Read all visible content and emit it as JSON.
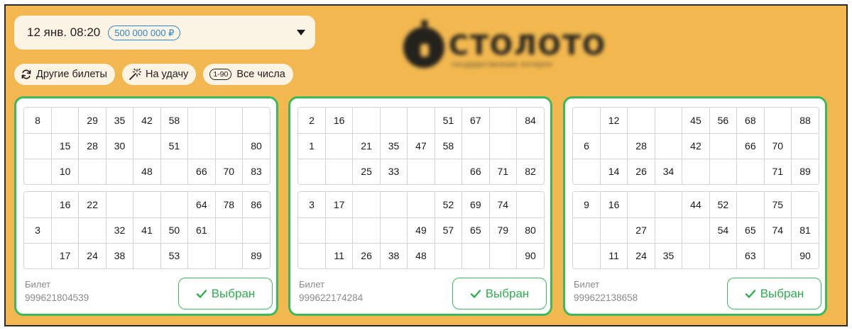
{
  "draw": {
    "date": "12 янв. 08:20",
    "jackpot": "500 000 000 ₽",
    "dropdown_icon": "caret-down-icon"
  },
  "logo": {
    "word": "СТОЛОТО",
    "subtitle": "государственная лотерея"
  },
  "actions": {
    "other_tickets": "Другие билеты",
    "other_tickets_icon": "refresh-icon",
    "random": "На удачу",
    "random_icon": "magic-wand-icon",
    "range_badge": "1-90",
    "all_numbers": "Все числа"
  },
  "colors": {
    "background": "#f2b84f",
    "accent_green": "#3cb95a",
    "jackpot_blue": "#2f86c7"
  },
  "tickets": [
    {
      "label": "Билет",
      "number": "999621804539",
      "button": "Выбран",
      "fields": [
        [
          [
            "8",
            "",
            "29",
            "35",
            "42",
            "58",
            "",
            "",
            ""
          ],
          [
            "",
            "15",
            "28",
            "30",
            "",
            "51",
            "",
            "",
            "80"
          ],
          [
            "",
            "10",
            "",
            "",
            "48",
            "",
            "66",
            "70",
            "83"
          ]
        ],
        [
          [
            "",
            "16",
            "22",
            "",
            "",
            "",
            "64",
            "78",
            "86"
          ],
          [
            "3",
            "",
            "",
            "32",
            "41",
            "50",
            "61",
            "",
            ""
          ],
          [
            "",
            "17",
            "24",
            "38",
            "",
            "53",
            "",
            "",
            "89"
          ]
        ]
      ]
    },
    {
      "label": "Билет",
      "number": "999622174284",
      "button": "Выбран",
      "fields": [
        [
          [
            "2",
            "16",
            "",
            "",
            "",
            "51",
            "67",
            "",
            "84"
          ],
          [
            "1",
            "",
            "21",
            "35",
            "47",
            "58",
            "",
            "",
            ""
          ],
          [
            "",
            "",
            "25",
            "33",
            "",
            "",
            "66",
            "71",
            "82"
          ]
        ],
        [
          [
            "3",
            "17",
            "",
            "",
            "",
            "52",
            "69",
            "74",
            ""
          ],
          [
            "",
            "",
            "",
            "",
            "49",
            "57",
            "65",
            "79",
            "80"
          ],
          [
            "",
            "11",
            "26",
            "38",
            "48",
            "",
            "",
            "",
            "90"
          ]
        ]
      ]
    },
    {
      "label": "Билет",
      "number": "999622138658",
      "button": "Выбран",
      "fields": [
        [
          [
            "",
            "12",
            "",
            "",
            "45",
            "56",
            "68",
            "",
            "88"
          ],
          [
            "6",
            "",
            "28",
            "",
            "42",
            "",
            "66",
            "70",
            ""
          ],
          [
            "",
            "14",
            "26",
            "34",
            "",
            "",
            "",
            "71",
            "89"
          ]
        ],
        [
          [
            "9",
            "16",
            "",
            "",
            "44",
            "52",
            "",
            "75",
            ""
          ],
          [
            "",
            "",
            "27",
            "",
            "",
            "54",
            "65",
            "74",
            "81"
          ],
          [
            "",
            "11",
            "24",
            "35",
            "",
            "",
            "63",
            "",
            "90"
          ]
        ]
      ]
    }
  ]
}
